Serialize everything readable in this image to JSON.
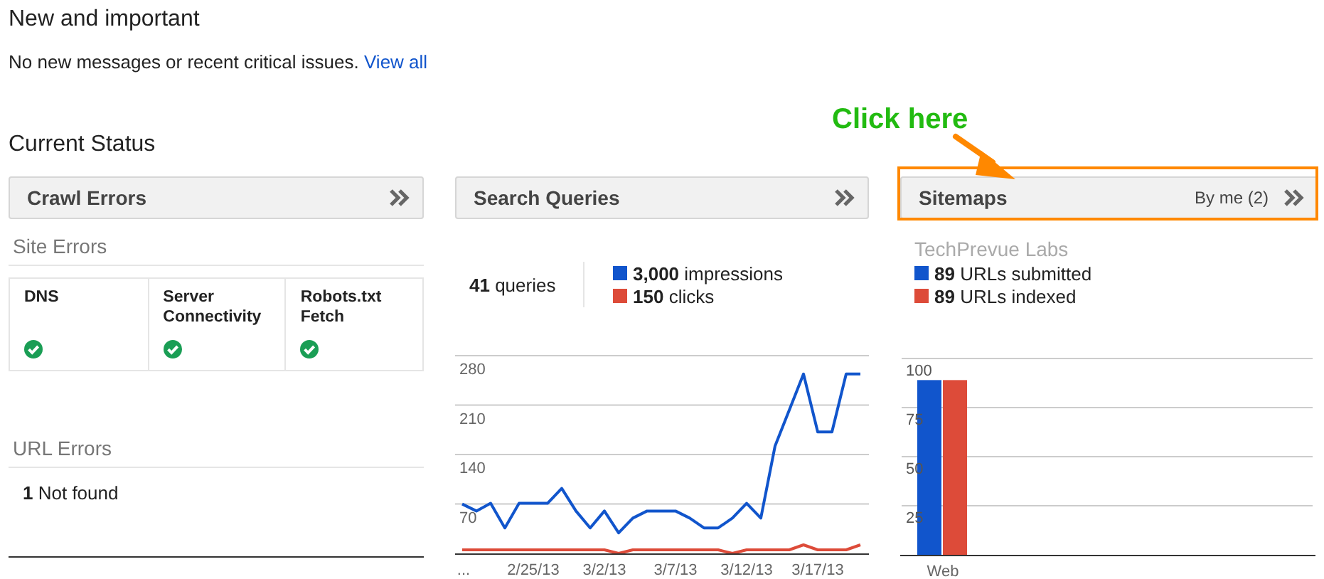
{
  "header": {
    "title": "New and important",
    "message": "No new messages or recent critical issues.",
    "link": "View all"
  },
  "current_status": {
    "title": "Current Status",
    "annotation": {
      "text": "Click here"
    },
    "crawl_errors": {
      "title": "Crawl Errors",
      "site_errors_title": "Site Errors",
      "site_errors": [
        {
          "label": "DNS",
          "ok": true
        },
        {
          "label": "Server Connectivity",
          "ok": true
        },
        {
          "label": "Robots.txt Fetch",
          "ok": true
        }
      ],
      "url_errors_title": "URL Errors",
      "url_errors": [
        "**1** Not found"
      ]
    },
    "search_queries": {
      "title": "Search Queries",
      "total": "**41** queries",
      "legend": [
        {
          "text": "**3,000** impressions",
          "color": "#1155cc"
        },
        {
          "text": "**150** clicks",
          "color": "#dd4b39"
        }
      ],
      "chart_data": {
        "type": "line",
        "grid": true,
        "categories": [
          "...",
          null,
          null,
          null,
          null,
          "2/25/13",
          null,
          null,
          null,
          null,
          "3/2/13",
          null,
          null,
          null,
          null,
          "3/7/13",
          null,
          null,
          null,
          null,
          "3/12/13",
          null,
          null,
          null,
          null,
          "3/17/13",
          null,
          null,
          null
        ],
        "series": [
          {
            "color": "#1155cc",
            "values": [
              70,
              60,
              71,
              36,
              71,
              71,
              71,
              92,
              60,
              36,
              60,
              29,
              50,
              60,
              60,
              60,
              50,
              36,
              36,
              50,
              71,
              50,
              152,
              203,
              254,
              172,
              172,
              254,
              254
            ]
          },
          {
            "color": "#dd4b39",
            "values": [
              5,
              5,
              5,
              5,
              5,
              5,
              5,
              5,
              5,
              5,
              5,
              0,
              5,
              5,
              5,
              5,
              5,
              5,
              5,
              0,
              5,
              5,
              5,
              5,
              12,
              5,
              5,
              5,
              12
            ]
          }
        ],
        "ylim": [
          0,
          280
        ],
        "yticks": [
          70,
          140,
          210,
          280
        ]
      }
    },
    "sitemaps": {
      "title": "Sitemaps",
      "filter": "By me (2)",
      "highlighted": true,
      "site": "TechPrevue Labs",
      "legend": [
        {
          "text": "**89** URLs submitted",
          "color": "#1155cc"
        },
        {
          "text": "**89** URLs indexed",
          "color": "#dd4b39"
        }
      ],
      "chart_data": {
        "type": "bar",
        "grid": true,
        "categories": [
          "Web"
        ],
        "series": [
          {
            "color": "#1155cc",
            "values": [
              89
            ]
          },
          {
            "color": "#dd4b39",
            "values": [
              89
            ]
          }
        ],
        "ylim": [
          0,
          100
        ],
        "yticks": [
          25,
          50,
          75,
          100
        ]
      }
    }
  }
}
